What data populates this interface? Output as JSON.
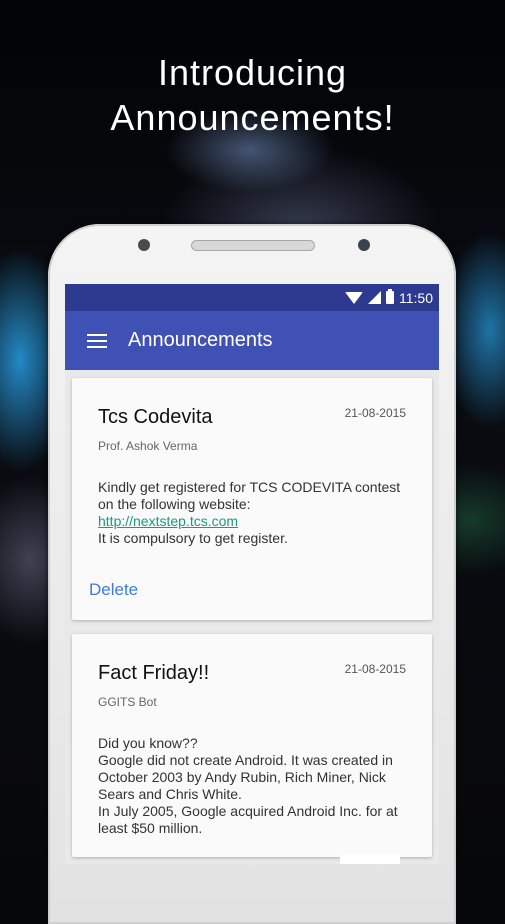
{
  "headline": {
    "line1": "Introducing",
    "line2": "Announcements!"
  },
  "statusbar": {
    "time": "11:50",
    "icons": [
      "wifi-icon",
      "signal-icon",
      "battery-icon"
    ]
  },
  "appbar": {
    "title": "Announcements",
    "menu_icon": "menu-icon"
  },
  "colors": {
    "status": "#2d3a8f",
    "primary": "#3f51b5",
    "accent": "#3f7be0",
    "link": "#1a9a7a"
  },
  "announcements": [
    {
      "title": "Tcs Codevita",
      "date": "21-08-2015",
      "author": "Prof. Ashok Verma",
      "body_line1": "Kindly get registered for TCS CODEVITA contest on the following website:",
      "link": "http://nextstep.tcs.com",
      "body_line2": "It is compulsory to get register.",
      "action": "Delete"
    },
    {
      "title": "Fact Friday!!",
      "date": "21-08-2015",
      "author": "GGITS Bot",
      "body_line1": "Did you know??",
      "body_line2": "Google did not create Android. It was created in October 2003 by Andy Rubin, Rich Miner, Nick Sears and Chris White.",
      "body_line3": "In July 2005, Google acquired Android Inc. for at least $50 million."
    }
  ]
}
